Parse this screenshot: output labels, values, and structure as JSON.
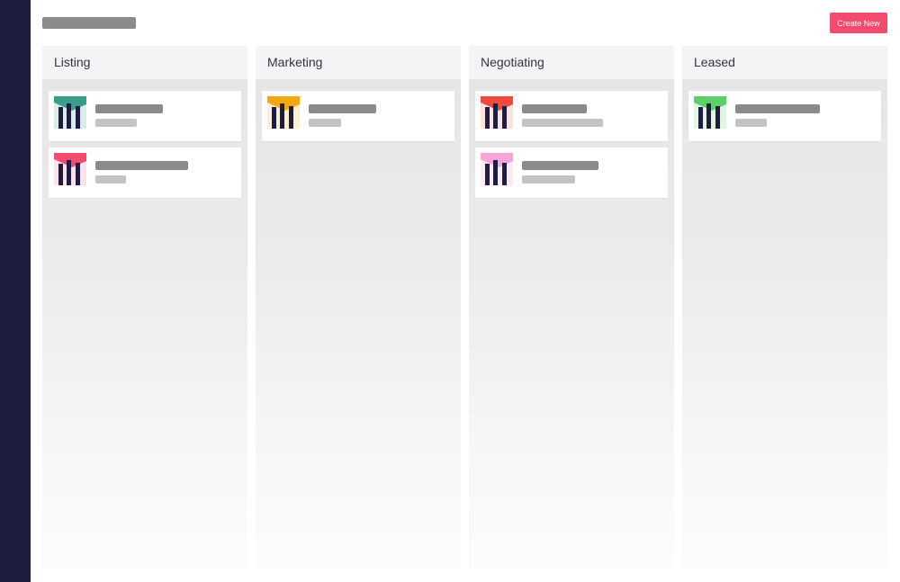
{
  "header": {
    "create_label": "Create New",
    "create_color": "#f24b6f"
  },
  "icon": {
    "name": "property-building-icon",
    "bar_color": "#1f1c42"
  },
  "columns": [
    {
      "label": "Listing",
      "cards": [
        {
          "accent": "#3a9d8c",
          "shade": "#d9eee9"
        },
        {
          "accent": "#f24b6f",
          "shade": "#fde2e8"
        }
      ]
    },
    {
      "label": "Marketing",
      "cards": [
        {
          "accent": "#f5a70f",
          "shade": "#fdf0d2"
        }
      ]
    },
    {
      "label": "Negotiating",
      "cards": [
        {
          "accent": "#ef4a3c",
          "shade": "#fde1dd"
        },
        {
          "accent": "#f7a5d8",
          "shade": "#fdeaf6"
        }
      ]
    },
    {
      "label": "Leased",
      "cards": [
        {
          "accent": "#5ccf6a",
          "shade": "#e0f6e3"
        }
      ]
    }
  ]
}
